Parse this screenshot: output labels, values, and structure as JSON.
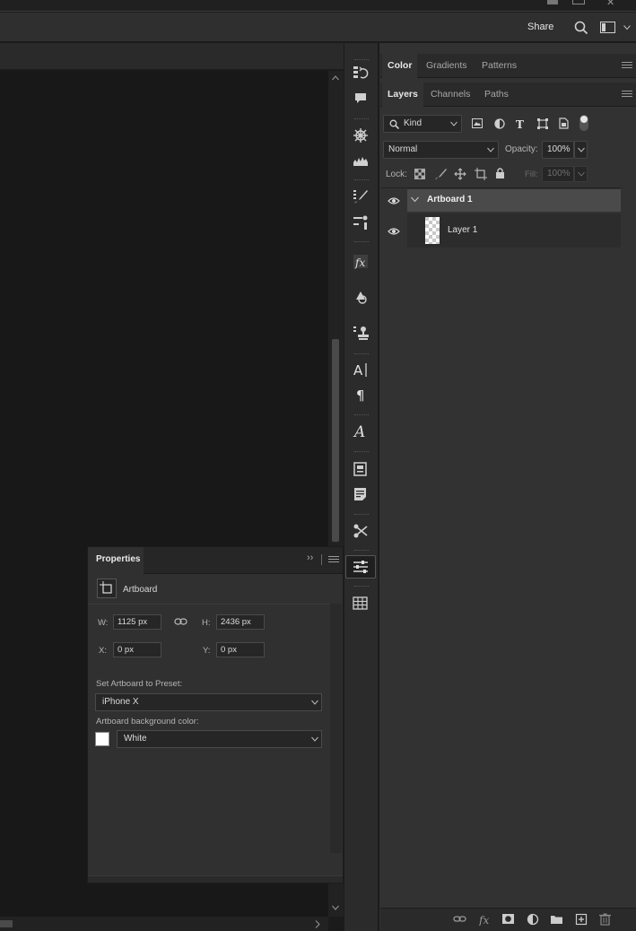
{
  "topbar": {
    "share_label": "Share",
    "icons": [
      "search-icon",
      "workspace-icon",
      "chevron-down-icon",
      "minimize-icon",
      "restore-icon",
      "close-icon"
    ]
  },
  "color_panel": {
    "tabs": [
      "Color",
      "Gradients",
      "Patterns"
    ],
    "active_tab": "Color"
  },
  "layers_panel": {
    "tabs": [
      "Layers",
      "Channels",
      "Paths"
    ],
    "active_tab": "Layers",
    "filter_kind": "Kind",
    "blend_mode": "Normal",
    "opacity_label": "Opacity:",
    "opacity_value": "100%",
    "lock_label": "Lock:",
    "fill_label": "Fill:",
    "fill_value": "100%",
    "layers": [
      {
        "name": "Artboard 1",
        "type": "artboard",
        "visible": true,
        "selected": true
      },
      {
        "name": "Layer 1",
        "type": "layer",
        "visible": true,
        "selected": false
      }
    ]
  },
  "properties_panel": {
    "title": "Properties",
    "section": "Artboard",
    "w_label": "W:",
    "w_value": "1125 px",
    "h_label": "H:",
    "h_value": "2436 px",
    "x_label": "X:",
    "x_value": "0 px",
    "y_label": "Y:",
    "y_value": "0 px",
    "preset_label": "Set Artboard to Preset:",
    "preset_value": "iPhone X",
    "bg_label": "Artboard background color:",
    "bg_value": "White",
    "bg_swatch": "#ffffff"
  },
  "icon_strip": [
    "history-icon",
    "comments-icon",
    "navigator-icon",
    "histogram-icon",
    "brush-settings-icon",
    "tool-presets-icon",
    "styles-icon",
    "shapes-icon",
    "clone-source-icon",
    "character-icon",
    "paragraph-icon",
    "glyphs-icon",
    "notes-icon",
    "info-icon",
    "actions-icon",
    "adjustments-icon",
    "table-icon"
  ],
  "colors": {
    "panel_bg": "#323232",
    "canvas_bg": "#181818",
    "selected_row": "#4a4a4a",
    "text": "#e8e8e8"
  }
}
